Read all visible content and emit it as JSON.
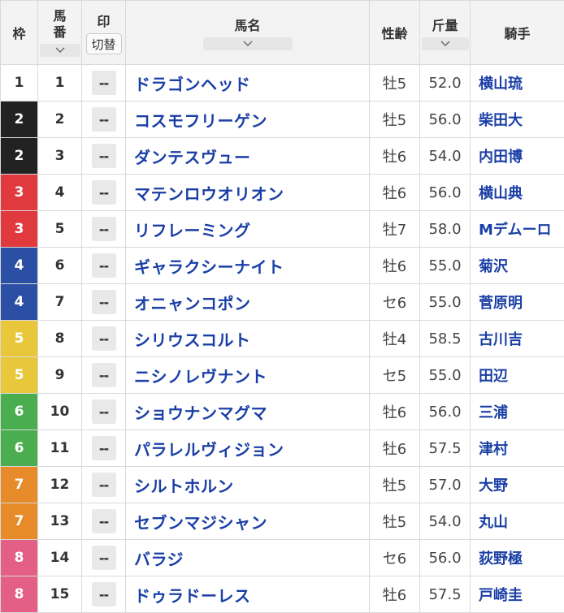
{
  "headers": {
    "waku": "枠",
    "umaban_top": "馬",
    "umaban_bottom": "番",
    "mark": "印",
    "mark_toggle": "切替",
    "horse_name": "馬名",
    "sex_age": "性齢",
    "weight": "斤量",
    "jockey": "騎手"
  },
  "icons": {
    "sort": "chevron-down-icon"
  },
  "waku_colors": {
    "1": "#ffffff",
    "2": "#222222",
    "3": "#e0393e",
    "4": "#2c4fa6",
    "5": "#e8c83a",
    "6": "#4aad4f",
    "7": "#e68a2a",
    "8": "#e45f86"
  },
  "rows": [
    {
      "waku": "1",
      "umaban": "1",
      "mark": "--",
      "horse": "ドラゴンヘッド",
      "sex_age": "牡5",
      "weight": "52.0",
      "jockey": "横山琉"
    },
    {
      "waku": "2",
      "umaban": "2",
      "mark": "--",
      "horse": "コスモフリーゲン",
      "sex_age": "牡5",
      "weight": "56.0",
      "jockey": "柴田大"
    },
    {
      "waku": "2",
      "umaban": "3",
      "mark": "--",
      "horse": "ダンテスヴュー",
      "sex_age": "牡6",
      "weight": "54.0",
      "jockey": "内田博"
    },
    {
      "waku": "3",
      "umaban": "4",
      "mark": "--",
      "horse": "マテンロウオリオン",
      "sex_age": "牡6",
      "weight": "56.0",
      "jockey": "横山典"
    },
    {
      "waku": "3",
      "umaban": "5",
      "mark": "--",
      "horse": "リフレーミング",
      "sex_age": "牡7",
      "weight": "58.0",
      "jockey": "Mデムーロ"
    },
    {
      "waku": "4",
      "umaban": "6",
      "mark": "--",
      "horse": "ギャラクシーナイト",
      "sex_age": "牡6",
      "weight": "55.0",
      "jockey": "菊沢"
    },
    {
      "waku": "4",
      "umaban": "7",
      "mark": "--",
      "horse": "オニャンコポン",
      "sex_age": "セ6",
      "weight": "55.0",
      "jockey": "菅原明"
    },
    {
      "waku": "5",
      "umaban": "8",
      "mark": "--",
      "horse": "シリウスコルト",
      "sex_age": "牡4",
      "weight": "58.5",
      "jockey": "古川吉"
    },
    {
      "waku": "5",
      "umaban": "9",
      "mark": "--",
      "horse": "ニシノレヴナント",
      "sex_age": "セ5",
      "weight": "55.0",
      "jockey": "田辺"
    },
    {
      "waku": "6",
      "umaban": "10",
      "mark": "--",
      "horse": "ショウナンマグマ",
      "sex_age": "牡6",
      "weight": "56.0",
      "jockey": "三浦"
    },
    {
      "waku": "6",
      "umaban": "11",
      "mark": "--",
      "horse": "パラレルヴィジョン",
      "sex_age": "牡6",
      "weight": "57.5",
      "jockey": "津村"
    },
    {
      "waku": "7",
      "umaban": "12",
      "mark": "--",
      "horse": "シルトホルン",
      "sex_age": "牡5",
      "weight": "57.0",
      "jockey": "大野"
    },
    {
      "waku": "7",
      "umaban": "13",
      "mark": "--",
      "horse": "セブンマジシャン",
      "sex_age": "牡5",
      "weight": "54.0",
      "jockey": "丸山"
    },
    {
      "waku": "8",
      "umaban": "14",
      "mark": "--",
      "horse": "バラジ",
      "sex_age": "セ6",
      "weight": "56.0",
      "jockey": "荻野極"
    },
    {
      "waku": "8",
      "umaban": "15",
      "mark": "--",
      "horse": "ドゥラドーレス",
      "sex_age": "牡6",
      "weight": "57.5",
      "jockey": "戸崎圭"
    }
  ]
}
